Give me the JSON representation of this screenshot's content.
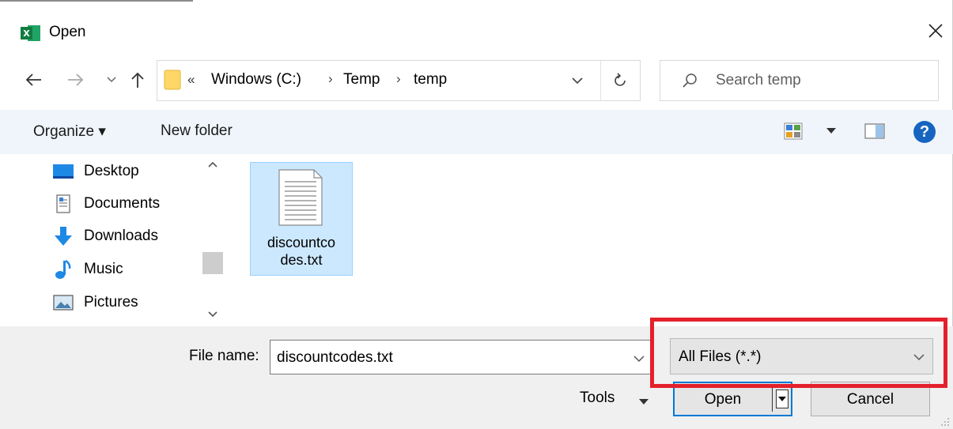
{
  "window": {
    "title": "Open",
    "app_icon": "excel-icon",
    "app_icon_letter": "X"
  },
  "nav": {
    "breadcrumb_overflow": "«",
    "breadcrumbs": [
      "Windows (C:)",
      "Temp",
      "temp"
    ],
    "separator": "›",
    "search_placeholder": "Search temp"
  },
  "toolbar": {
    "organize_label": "Organize ▾",
    "new_folder_label": "New folder",
    "help_label": "?"
  },
  "tree": {
    "items": [
      {
        "label": "Desktop",
        "icon": "desktop-icon"
      },
      {
        "label": "Documents",
        "icon": "documents-icon"
      },
      {
        "label": "Downloads",
        "icon": "downloads-icon"
      },
      {
        "label": "Music",
        "icon": "music-icon"
      },
      {
        "label": "Pictures",
        "icon": "pictures-icon"
      }
    ]
  },
  "content": {
    "files": [
      {
        "name_line1": "discountco",
        "name_line2": "des.txt",
        "icon": "text-file-icon",
        "selected": true
      }
    ]
  },
  "bottom": {
    "file_name_label": "File name:",
    "file_name_value": "discountcodes.txt",
    "filter_value": "All Files (*.*)",
    "tools_label": "Tools",
    "open_label": "Open",
    "cancel_label": "Cancel"
  },
  "colors": {
    "highlight": "#e4202b",
    "selection": "#cce8ff",
    "accent": "#0078d7"
  }
}
